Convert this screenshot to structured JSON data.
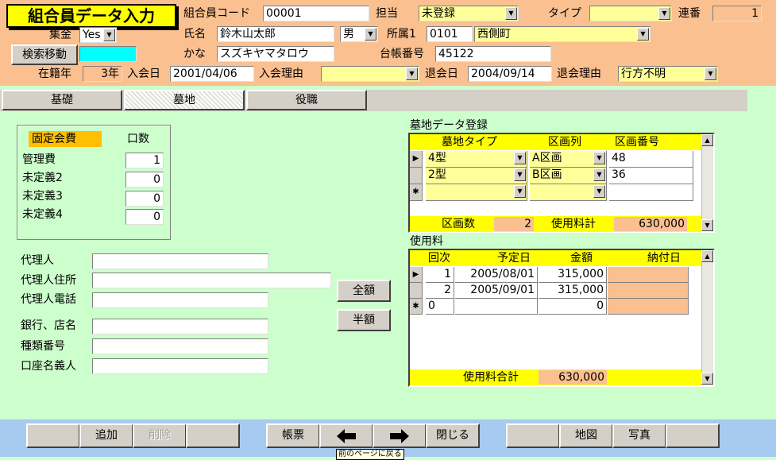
{
  "app": {
    "title": "組合員データ入力"
  },
  "header": {
    "member_code_label": "組合員コード",
    "member_code": "00001",
    "staff_label": "担当",
    "staff_value": "未登録",
    "type_label": "タイプ",
    "type_value": "",
    "serial_label": "連番",
    "serial_value": "1",
    "collect_label": "集金",
    "collect_value": "Yes",
    "name_label": "氏名",
    "name_value": "鈴木山太郎",
    "sex_value": "男",
    "dept1_label": "所属1",
    "dept1_code": "0101",
    "dept1_name": "西側町",
    "search_move_btn": "検索移動",
    "search_move_value": "",
    "kana_label": "かな",
    "kana_value": "スズキヤマタロウ",
    "ledger_label": "台帳番号",
    "ledger_value": "45122",
    "years_label": "在籍年",
    "years_value": "3年",
    "join_date_label": "入会日",
    "join_date": "2001/04/06",
    "join_reason_label": "入会理由",
    "join_reason": "",
    "leave_date_label": "退会日",
    "leave_date": "2004/09/14",
    "leave_reason_label": "退会理由",
    "leave_reason": "行方不明"
  },
  "tabs": [
    {
      "label": "基礎"
    },
    {
      "label": "墓地"
    },
    {
      "label": "役職"
    }
  ],
  "fees": {
    "header_label": "固定会費",
    "units_label": "口数",
    "rows": [
      {
        "label": "管理費",
        "value": "1"
      },
      {
        "label": "未定義2",
        "value": "0"
      },
      {
        "label": "未定義3",
        "value": "0"
      },
      {
        "label": "未定義4",
        "value": "0"
      }
    ]
  },
  "agent": {
    "agent_label": "代理人",
    "agent_value": "",
    "address_label": "代理人住所",
    "address_value": "",
    "phone_label": "代理人電話",
    "phone_value": "",
    "bank_label": "銀行、店名",
    "bank_value": "",
    "kind_label": "種類番号",
    "kind_value": "",
    "holder_label": "口座名義人",
    "holder_value": ""
  },
  "buttons": {
    "full": "全額",
    "half": "半額"
  },
  "grave": {
    "section_label": "墓地データ登録",
    "columns": [
      "墓地タイプ",
      "区画列",
      "区画番号"
    ],
    "rows": [
      {
        "type": "4型",
        "row": "A区画",
        "number": "48"
      },
      {
        "type": "2型",
        "row": "B区画",
        "number": "36"
      }
    ],
    "count_label": "区画数",
    "count_value": "2",
    "fee_total_label": "使用料計",
    "fee_total_value": "630,000"
  },
  "usage": {
    "section_label": "使用料",
    "columns": [
      "回次",
      "予定日",
      "金額",
      "納付日"
    ],
    "rows": [
      {
        "times": "1",
        "date": "2005/08/01",
        "amount": "315,000",
        "paid": ""
      },
      {
        "times": "2",
        "date": "2005/09/01",
        "amount": "315,000",
        "paid": ""
      }
    ],
    "new_row": {
      "times": "0",
      "amount": "0"
    },
    "total_label": "使用料合計",
    "total_value": "630,000"
  },
  "footer": {
    "add": "追加",
    "delete": "削除",
    "form": "帳票",
    "close": "閉じる",
    "map": "地図",
    "photo": "写真",
    "tooltip": "前のページに戻る"
  }
}
